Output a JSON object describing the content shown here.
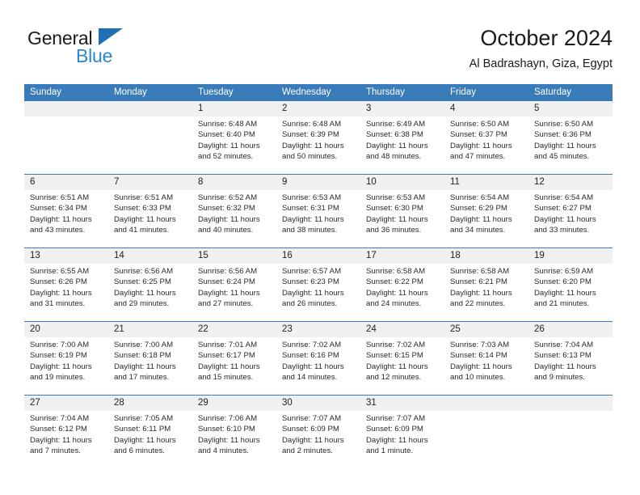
{
  "logo": {
    "word_top": "General",
    "word_bottom": "Blue",
    "triangle_icon": "triangle-icon",
    "color_dark": "#1b1b1b",
    "color_blue": "#2b86d0"
  },
  "header": {
    "title": "October 2024",
    "subtitle": "Al Badrashayn, Giza, Egypt"
  },
  "theme": {
    "header_bg": "#3a7cba",
    "header_text": "#ffffff",
    "daynum_bg": "#f0f0f0",
    "cell_bg": "#ffffff",
    "rule_color": "#3a7cba"
  },
  "calendar": {
    "day_headers": [
      "Sunday",
      "Monday",
      "Tuesday",
      "Wednesday",
      "Thursday",
      "Friday",
      "Saturday"
    ],
    "weeks": [
      [
        {
          "day": "",
          "sunrise": "",
          "sunset": "",
          "daylight": ""
        },
        {
          "day": "",
          "sunrise": "",
          "sunset": "",
          "daylight": ""
        },
        {
          "day": "1",
          "sunrise": "Sunrise: 6:48 AM",
          "sunset": "Sunset: 6:40 PM",
          "daylight": "Daylight: 11 hours and 52 minutes."
        },
        {
          "day": "2",
          "sunrise": "Sunrise: 6:48 AM",
          "sunset": "Sunset: 6:39 PM",
          "daylight": "Daylight: 11 hours and 50 minutes."
        },
        {
          "day": "3",
          "sunrise": "Sunrise: 6:49 AM",
          "sunset": "Sunset: 6:38 PM",
          "daylight": "Daylight: 11 hours and 48 minutes."
        },
        {
          "day": "4",
          "sunrise": "Sunrise: 6:50 AM",
          "sunset": "Sunset: 6:37 PM",
          "daylight": "Daylight: 11 hours and 47 minutes."
        },
        {
          "day": "5",
          "sunrise": "Sunrise: 6:50 AM",
          "sunset": "Sunset: 6:36 PM",
          "daylight": "Daylight: 11 hours and 45 minutes."
        }
      ],
      [
        {
          "day": "6",
          "sunrise": "Sunrise: 6:51 AM",
          "sunset": "Sunset: 6:34 PM",
          "daylight": "Daylight: 11 hours and 43 minutes."
        },
        {
          "day": "7",
          "sunrise": "Sunrise: 6:51 AM",
          "sunset": "Sunset: 6:33 PM",
          "daylight": "Daylight: 11 hours and 41 minutes."
        },
        {
          "day": "8",
          "sunrise": "Sunrise: 6:52 AM",
          "sunset": "Sunset: 6:32 PM",
          "daylight": "Daylight: 11 hours and 40 minutes."
        },
        {
          "day": "9",
          "sunrise": "Sunrise: 6:53 AM",
          "sunset": "Sunset: 6:31 PM",
          "daylight": "Daylight: 11 hours and 38 minutes."
        },
        {
          "day": "10",
          "sunrise": "Sunrise: 6:53 AM",
          "sunset": "Sunset: 6:30 PM",
          "daylight": "Daylight: 11 hours and 36 minutes."
        },
        {
          "day": "11",
          "sunrise": "Sunrise: 6:54 AM",
          "sunset": "Sunset: 6:29 PM",
          "daylight": "Daylight: 11 hours and 34 minutes."
        },
        {
          "day": "12",
          "sunrise": "Sunrise: 6:54 AM",
          "sunset": "Sunset: 6:27 PM",
          "daylight": "Daylight: 11 hours and 33 minutes."
        }
      ],
      [
        {
          "day": "13",
          "sunrise": "Sunrise: 6:55 AM",
          "sunset": "Sunset: 6:26 PM",
          "daylight": "Daylight: 11 hours and 31 minutes."
        },
        {
          "day": "14",
          "sunrise": "Sunrise: 6:56 AM",
          "sunset": "Sunset: 6:25 PM",
          "daylight": "Daylight: 11 hours and 29 minutes."
        },
        {
          "day": "15",
          "sunrise": "Sunrise: 6:56 AM",
          "sunset": "Sunset: 6:24 PM",
          "daylight": "Daylight: 11 hours and 27 minutes."
        },
        {
          "day": "16",
          "sunrise": "Sunrise: 6:57 AM",
          "sunset": "Sunset: 6:23 PM",
          "daylight": "Daylight: 11 hours and 26 minutes."
        },
        {
          "day": "17",
          "sunrise": "Sunrise: 6:58 AM",
          "sunset": "Sunset: 6:22 PM",
          "daylight": "Daylight: 11 hours and 24 minutes."
        },
        {
          "day": "18",
          "sunrise": "Sunrise: 6:58 AM",
          "sunset": "Sunset: 6:21 PM",
          "daylight": "Daylight: 11 hours and 22 minutes."
        },
        {
          "day": "19",
          "sunrise": "Sunrise: 6:59 AM",
          "sunset": "Sunset: 6:20 PM",
          "daylight": "Daylight: 11 hours and 21 minutes."
        }
      ],
      [
        {
          "day": "20",
          "sunrise": "Sunrise: 7:00 AM",
          "sunset": "Sunset: 6:19 PM",
          "daylight": "Daylight: 11 hours and 19 minutes."
        },
        {
          "day": "21",
          "sunrise": "Sunrise: 7:00 AM",
          "sunset": "Sunset: 6:18 PM",
          "daylight": "Daylight: 11 hours and 17 minutes."
        },
        {
          "day": "22",
          "sunrise": "Sunrise: 7:01 AM",
          "sunset": "Sunset: 6:17 PM",
          "daylight": "Daylight: 11 hours and 15 minutes."
        },
        {
          "day": "23",
          "sunrise": "Sunrise: 7:02 AM",
          "sunset": "Sunset: 6:16 PM",
          "daylight": "Daylight: 11 hours and 14 minutes."
        },
        {
          "day": "24",
          "sunrise": "Sunrise: 7:02 AM",
          "sunset": "Sunset: 6:15 PM",
          "daylight": "Daylight: 11 hours and 12 minutes."
        },
        {
          "day": "25",
          "sunrise": "Sunrise: 7:03 AM",
          "sunset": "Sunset: 6:14 PM",
          "daylight": "Daylight: 11 hours and 10 minutes."
        },
        {
          "day": "26",
          "sunrise": "Sunrise: 7:04 AM",
          "sunset": "Sunset: 6:13 PM",
          "daylight": "Daylight: 11 hours and 9 minutes."
        }
      ],
      [
        {
          "day": "27",
          "sunrise": "Sunrise: 7:04 AM",
          "sunset": "Sunset: 6:12 PM",
          "daylight": "Daylight: 11 hours and 7 minutes."
        },
        {
          "day": "28",
          "sunrise": "Sunrise: 7:05 AM",
          "sunset": "Sunset: 6:11 PM",
          "daylight": "Daylight: 11 hours and 6 minutes."
        },
        {
          "day": "29",
          "sunrise": "Sunrise: 7:06 AM",
          "sunset": "Sunset: 6:10 PM",
          "daylight": "Daylight: 11 hours and 4 minutes."
        },
        {
          "day": "30",
          "sunrise": "Sunrise: 7:07 AM",
          "sunset": "Sunset: 6:09 PM",
          "daylight": "Daylight: 11 hours and 2 minutes."
        },
        {
          "day": "31",
          "sunrise": "Sunrise: 7:07 AM",
          "sunset": "Sunset: 6:09 PM",
          "daylight": "Daylight: 11 hours and 1 minute."
        },
        {
          "day": "",
          "sunrise": "",
          "sunset": "",
          "daylight": ""
        },
        {
          "day": "",
          "sunrise": "",
          "sunset": "",
          "daylight": ""
        }
      ]
    ]
  }
}
